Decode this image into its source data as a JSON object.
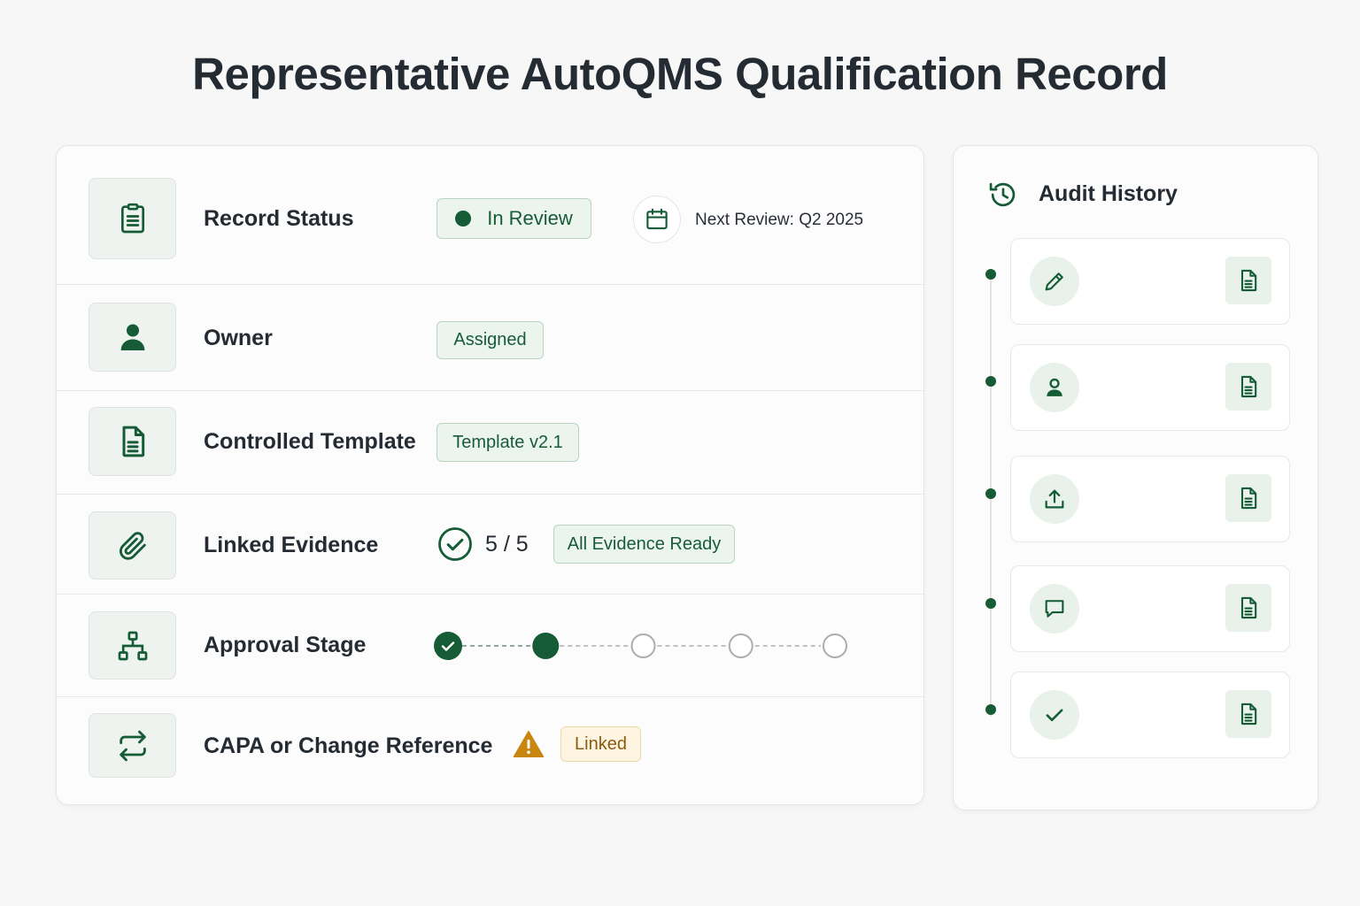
{
  "page": {
    "title": "Representative AutoQMS Qualification Record"
  },
  "colors": {
    "accent": "#155c36",
    "pill_bg": "#ecf4ee",
    "warning": "#c8860f",
    "warning_bg": "#fdf5e2"
  },
  "record": {
    "status": {
      "label": "Record Status",
      "icon": "clipboard-icon",
      "value": "In Review",
      "next_review": "Next Review: Q2 2025"
    },
    "owner": {
      "label": "Owner",
      "icon": "user-icon",
      "value": "Assigned"
    },
    "template": {
      "label": "Controlled Template",
      "icon": "document-icon",
      "value": "Template v2.1"
    },
    "evidence": {
      "label": "Linked Evidence",
      "icon": "paperclip-icon",
      "count": "5 / 5",
      "value": "All Evidence Ready"
    },
    "approval": {
      "label": "Approval Stage",
      "icon": "hierarchy-icon",
      "stages_total": 5,
      "completed": 1,
      "current": 2
    },
    "capa": {
      "label": "CAPA or Change Reference",
      "icon": "swap-arrows-icon",
      "value": "Linked",
      "alert_icon": "warning-icon"
    }
  },
  "audit": {
    "title": "Audit History",
    "icon": "history-icon",
    "entries": [
      {
        "icon": "pencil-icon",
        "doc_icon": "document-icon"
      },
      {
        "icon": "user-icon",
        "doc_icon": "document-icon"
      },
      {
        "icon": "upload-icon",
        "doc_icon": "document-icon"
      },
      {
        "icon": "comment-icon",
        "doc_icon": "document-icon"
      },
      {
        "icon": "check-icon",
        "doc_icon": "document-icon"
      }
    ]
  }
}
